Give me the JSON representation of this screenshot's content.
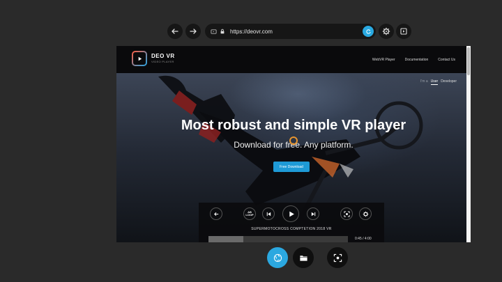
{
  "browser": {
    "url": "https://deovr.com",
    "icons": {
      "back": "arrow-left-icon",
      "forward": "arrow-right-icon",
      "tab": "tab-icon",
      "lock": "lock-icon",
      "go": "refresh-icon",
      "settings": "gear-icon",
      "library": "media-library-icon"
    }
  },
  "site": {
    "logo_title": "DEO VR",
    "logo_sub": "VIDEO PLAYER",
    "nav": [
      "WebVR Player",
      "Documentation",
      "Contact Us"
    ],
    "toggle": {
      "off": "I'm a",
      "user": "User",
      "developer": "Developer"
    },
    "hero_title": "Most robust and simple VR player",
    "hero_sub": "Download for free. Any platform.",
    "cta": "Free Download"
  },
  "player": {
    "ab_top": "AB",
    "ab_bottom": "LOOP",
    "video_title": "SUPERMOTOCROSS COMPTETION 2018 VR",
    "time": "0:45 / 4:00",
    "progress": 0.25,
    "icons": [
      "back-icon",
      "ab-loop-icon",
      "skip-previous-icon",
      "play-icon",
      "skip-next-icon",
      "recenter-icon",
      "gear-icon"
    ]
  },
  "dock": {
    "icons": [
      "globe-icon",
      "folder-icon",
      "recenter-icon"
    ],
    "accent": "#2ba8e0"
  },
  "colors": {
    "background": "#2a2a2a",
    "accent": "#29a9e1",
    "cta": "#1e9ad6",
    "cursor": "#e8952f"
  }
}
